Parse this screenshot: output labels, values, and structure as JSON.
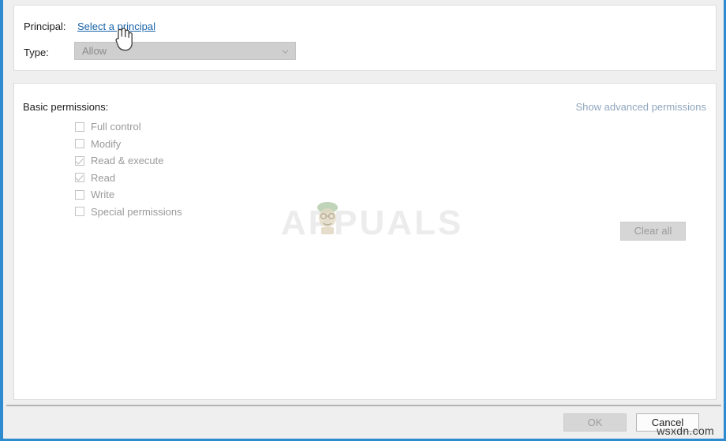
{
  "window": {
    "accent_color": "#2e8bd0",
    "panel_background": "#ffffff",
    "footer_background": "#efefef"
  },
  "principal_section": {
    "principal_label": "Principal:",
    "principal_link": "Select a principal",
    "principal_link_color": "#1763a8",
    "type_label": "Type:",
    "type_value": "Allow",
    "type_chevron_icon": "chevron-down-icon"
  },
  "permissions_section": {
    "heading": "Basic permissions:",
    "advanced_link": "Show advanced permissions",
    "advanced_link_color": "#8fa6bd",
    "clear_all_label": "Clear all",
    "items": [
      {
        "label": "Full control",
        "checked": false
      },
      {
        "label": "Modify",
        "checked": false
      },
      {
        "label": "Read & execute",
        "checked": true
      },
      {
        "label": "Read",
        "checked": true
      },
      {
        "label": "Write",
        "checked": false
      },
      {
        "label": "Special permissions",
        "checked": false
      }
    ]
  },
  "footer": {
    "ok_label": "OK",
    "cancel_label": "Cancel"
  },
  "watermarks": {
    "brand": "APPUALS",
    "site": "wsxdn.com"
  }
}
